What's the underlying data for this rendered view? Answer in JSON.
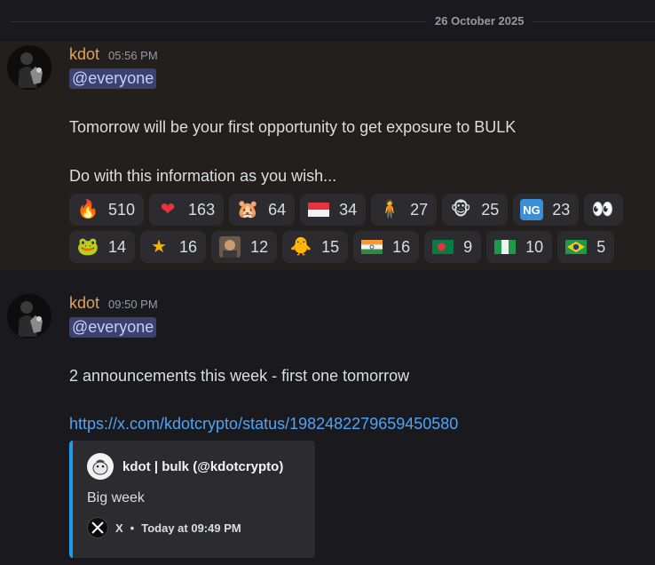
{
  "date_divider": "26 October 2025",
  "messages": [
    {
      "author": "kdot",
      "time": "05:56 PM",
      "mention": "@everyone",
      "lines": [
        "Tomorrow will be your first opportunity to get exposure to BULK",
        "Do with this information as you wish..."
      ],
      "reactions_row1": [
        {
          "icon": "fire-emoji",
          "glyph": "🔥",
          "count": "510"
        },
        {
          "icon": "red-heart-emoji",
          "glyph": "❤",
          "count": "163"
        },
        {
          "icon": "hamster-emoji",
          "glyph": "🐹",
          "count": "64"
        },
        {
          "icon": "flag-indonesia-emoji",
          "glyph": "",
          "count": "34"
        },
        {
          "icon": "figure-emoji",
          "glyph": "🧍",
          "count": "27"
        },
        {
          "icon": "monkey-emoji",
          "glyph": "🐵",
          "count": "25"
        },
        {
          "icon": "ng-sticker-emoji",
          "glyph": "NG",
          "count": "23"
        },
        {
          "icon": "eyes-emoji",
          "glyph": "👀",
          "count": ""
        }
      ],
      "reactions_row2": [
        {
          "icon": "frog-emoji",
          "glyph": "🐸",
          "count": "14"
        },
        {
          "icon": "star-emoji",
          "glyph": "⭐",
          "count": "16"
        },
        {
          "icon": "person-photo-emoji",
          "glyph": "🙂",
          "count": "12"
        },
        {
          "icon": "duck-emoji",
          "glyph": "🐥",
          "count": "15"
        },
        {
          "icon": "flag-india-emoji",
          "glyph": "",
          "count": "16"
        },
        {
          "icon": "flag-bangladesh-emoji",
          "glyph": "",
          "count": "9"
        },
        {
          "icon": "flag-nigeria-emoji",
          "glyph": "",
          "count": "10"
        },
        {
          "icon": "flag-brazil-emoji",
          "glyph": "",
          "count": "5"
        }
      ]
    },
    {
      "author": "kdot",
      "time": "09:50 PM",
      "mention": "@everyone",
      "lines": [
        "2 announcements this week - first one tomorrow"
      ],
      "link": "https://x.com/kdotcrypto/status/1982482279659450580",
      "embed": {
        "author": "kdot | bulk (@kdotcrypto)",
        "description": "Big week",
        "footer_source": "X",
        "footer_separator": "•",
        "footer_time": "Today at 09:49 PM"
      }
    }
  ],
  "colors": {
    "author": "#e3a25b",
    "mention_bg": "#3c4270",
    "link": "#4ea4f5",
    "embed_border": "#1d9bf0"
  }
}
